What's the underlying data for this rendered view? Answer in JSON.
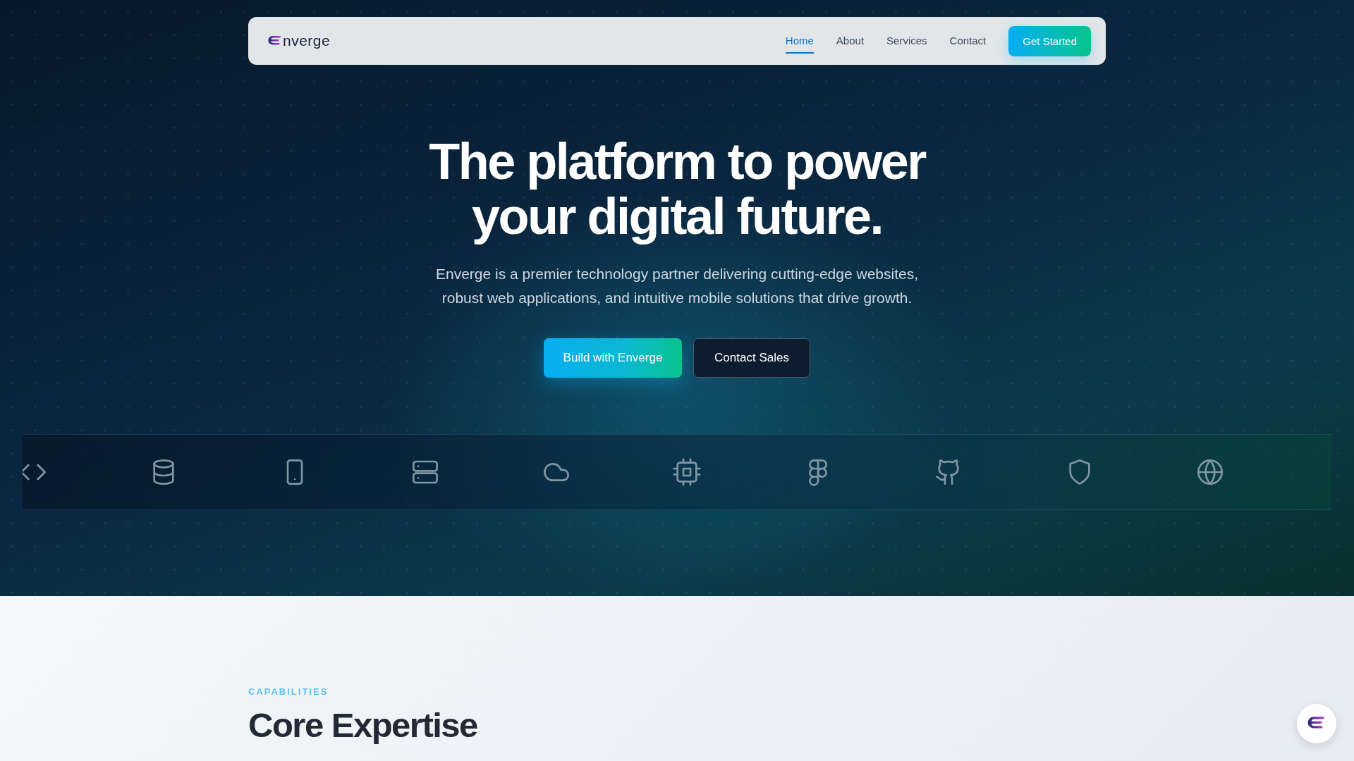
{
  "nav": {
    "logo_text": "nverge",
    "links": [
      {
        "label": "Home",
        "selected": true
      },
      {
        "label": "About",
        "selected": false
      },
      {
        "label": "Services",
        "selected": false
      },
      {
        "label": "Contact",
        "selected": false
      }
    ],
    "cta": "Get Started"
  },
  "hero": {
    "title_lines": [
      "The platform to power",
      "your digital future."
    ],
    "subtitle_lines": [
      "Enverge is a premier technology partner delivering cutting-edge websites,",
      "robust web applications, and intuitive mobile solutions that drive growth."
    ],
    "primary_button": "Build with Enverge",
    "secondary_button": "Contact Sales"
  },
  "tech_strip": [
    {
      "kind": "code"
    },
    {
      "kind": "database"
    },
    {
      "kind": "tablet"
    },
    {
      "kind": "server"
    },
    {
      "kind": "cloud"
    },
    {
      "kind": "chip"
    },
    {
      "kind": "shapes"
    },
    {
      "kind": "cat"
    },
    {
      "kind": "shield"
    },
    {
      "kind": "globe"
    }
  ],
  "section": {
    "eyebrow": "CAPABILITIES",
    "title": "Core Expertise"
  }
}
